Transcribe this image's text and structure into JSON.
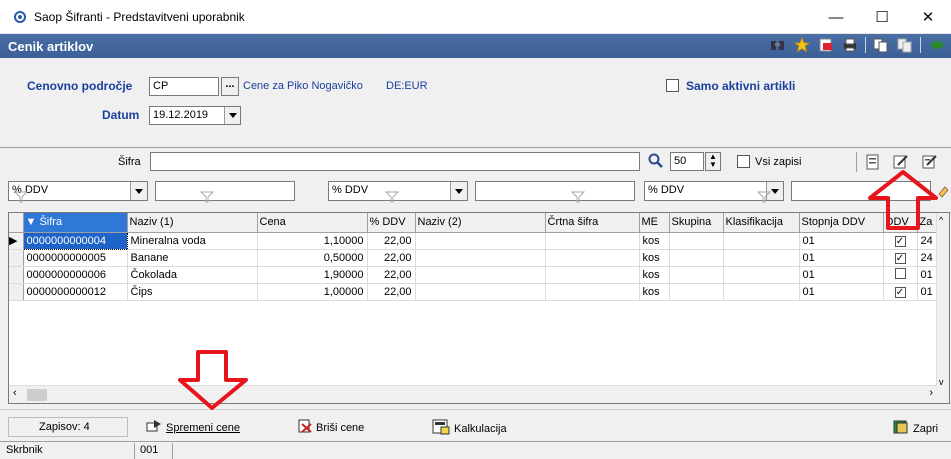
{
  "window": {
    "title": "Saop Šifranti - Predstavitveni uporabnik",
    "controls": [
      "—",
      "☐",
      "✕"
    ]
  },
  "header": {
    "title": "Cenik artiklov",
    "icons": [
      "binoculars-icon",
      "star-icon",
      "export-icon",
      "print-icon",
      "copy-icon",
      "copy-disabled-icon",
      "exit-icon"
    ]
  },
  "form": {
    "price_area_label": "Cenovno področje",
    "price_area_value": "CP",
    "price_area_dots": "...",
    "price_area_desc": "Cene za Piko Nogavičko",
    "currency": "DE:EUR",
    "only_active_label": "Samo aktivni artikli",
    "date_label": "Datum",
    "date_value": "19.12.2019"
  },
  "filters": {
    "sifra_label": "Šifra",
    "sifra_value": "",
    "count_value": "50",
    "all_records_label": "Vsi zapisi",
    "combo_1": "% DDV",
    "combo_2": "% DDV",
    "combo_3": "% DDV"
  },
  "grid": {
    "columns": [
      "Šifra",
      "Naziv (1)",
      "Cena",
      "% DDV",
      "Naziv (2)",
      "Črtna šifra",
      "ME",
      "Skupina",
      "Klasifikacija",
      "Stopnja DDV",
      "DDV",
      "Za"
    ],
    "rows": [
      {
        "sifra": "0000000000004",
        "naziv": "Mineralna voda",
        "cena": "1,10000",
        "ddv": "22,00",
        "me": "kos",
        "stopnja": "01",
        "ddv_chk": "✓",
        "za": "24"
      },
      {
        "sifra": "0000000000005",
        "naziv": "Banane",
        "cena": "0,50000",
        "ddv": "22,00",
        "me": "kos",
        "stopnja": "01",
        "ddv_chk": "✓",
        "za": "24"
      },
      {
        "sifra": "0000000000006",
        "naziv": "Čokolada",
        "cena": "1,90000",
        "ddv": "22,00",
        "me": "kos",
        "stopnja": "01",
        "ddv_chk": "",
        "za": "01"
      },
      {
        "sifra": "0000000000012",
        "naziv": "Čips",
        "cena": "1,00000",
        "ddv": "22,00",
        "me": "kos",
        "stopnja": "01",
        "ddv_chk": "✓",
        "za": "01"
      }
    ]
  },
  "bottom": {
    "records": "Zapisov: 4",
    "change_prices": "Spremeni cene",
    "delete_prices": "Briši cene",
    "calculation": "Kalkulacija",
    "close": "Zapri"
  },
  "status": {
    "user": "Skrbnik",
    "code": "001"
  },
  "colors": {
    "header_bg": "#3b5f96",
    "label_blue": "#1a3f9e",
    "selection": "#1e64c8",
    "arrow_red": "#e8141c"
  }
}
